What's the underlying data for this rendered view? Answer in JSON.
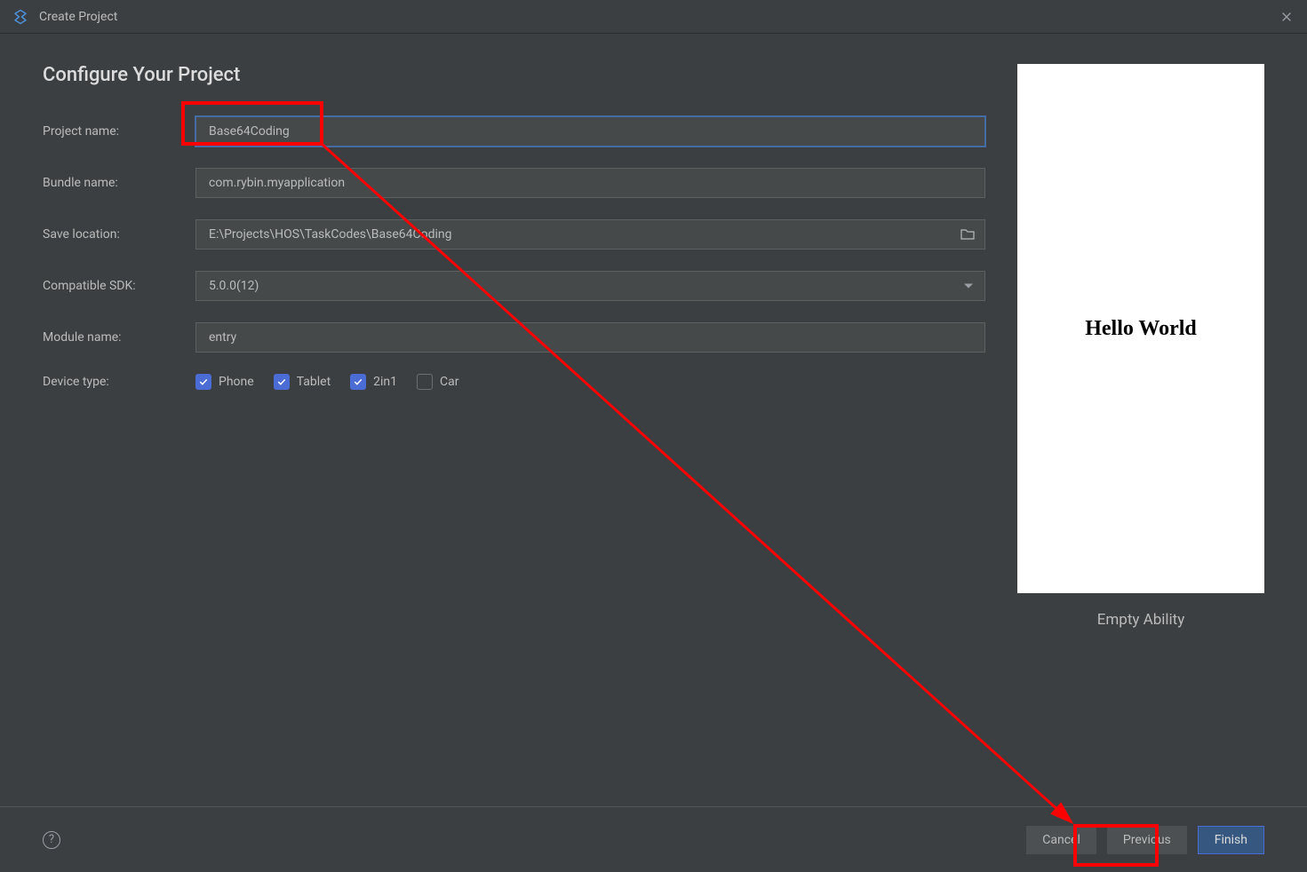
{
  "titlebar": {
    "title": "Create Project"
  },
  "page": {
    "title": "Configure Your Project"
  },
  "form": {
    "project_name": {
      "label": "Project name:",
      "value": "Base64Coding"
    },
    "bundle_name": {
      "label": "Bundle name:",
      "value": "com.rybin.myapplication"
    },
    "save_location": {
      "label": "Save location:",
      "value": "E:\\Projects\\HOS\\TaskCodes\\Base64Coding"
    },
    "compatible_sdk": {
      "label": "Compatible SDK:",
      "value": "5.0.0(12)"
    },
    "module_name": {
      "label": "Module name:",
      "value": "entry"
    },
    "device_type": {
      "label": "Device type:",
      "options": [
        {
          "label": "Phone",
          "checked": true
        },
        {
          "label": "Tablet",
          "checked": true
        },
        {
          "label": "2in1",
          "checked": true
        },
        {
          "label": "Car",
          "checked": false
        }
      ]
    }
  },
  "preview": {
    "text": "Hello World",
    "label": "Empty Ability"
  },
  "footer": {
    "help": "?",
    "cancel": "Cancel",
    "previous": "Previous",
    "finish": "Finish"
  }
}
